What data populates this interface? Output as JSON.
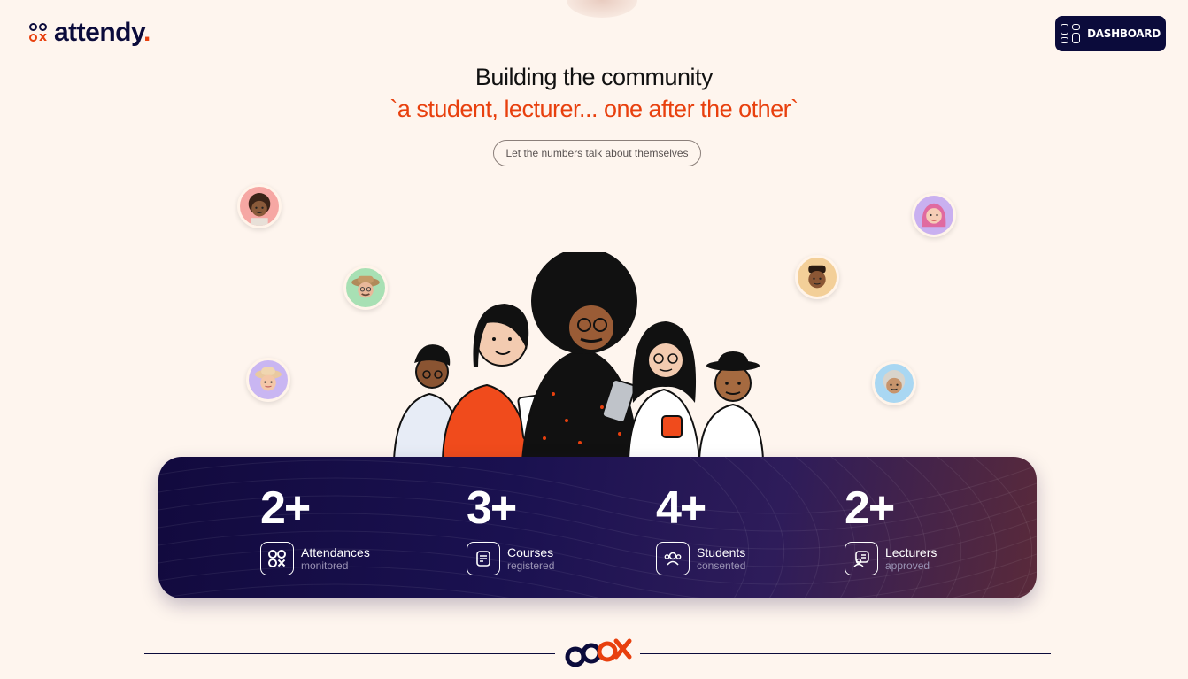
{
  "header": {
    "logo_text": "attendy",
    "logo_dot": ".",
    "dashboard_label": "DASHBOARD"
  },
  "hero": {
    "title": "Building the community",
    "subtitle": "`a student, lecturer... one after the other`",
    "pill": "Let the numbers talk about themselves"
  },
  "stats": [
    {
      "number": "2+",
      "label": "Attendances",
      "sub": "monitored",
      "icon": "attendy-logo-icon"
    },
    {
      "number": "3+",
      "label": "Courses",
      "sub": "registered",
      "icon": "document-icon"
    },
    {
      "number": "4+",
      "label": "Students",
      "sub": "consented",
      "icon": "users-icon"
    },
    {
      "number": "2+",
      "label": "Lecturers",
      "sub": "approved",
      "icon": "lecturer-icon"
    }
  ],
  "colors": {
    "background": "#fef5ee",
    "navy": "#0b0b3b",
    "accent": "#e8400e"
  }
}
